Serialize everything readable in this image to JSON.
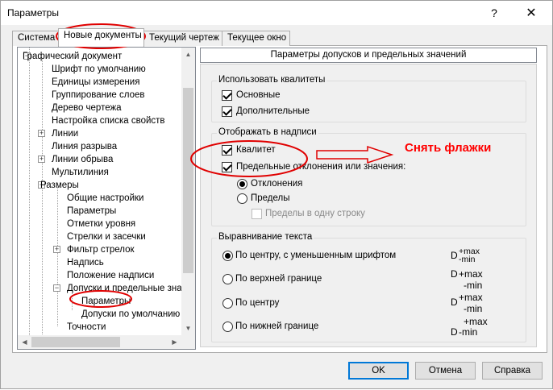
{
  "window": {
    "title": "Параметры",
    "help": "?",
    "close": "✕"
  },
  "tabs": [
    "Система",
    "Новые документы",
    "Текущий чертеж",
    "Текущее окно"
  ],
  "tree": [
    {
      "label": "Графический документ",
      "exp": "−"
    },
    {
      "label": "Шрифт по умолчанию"
    },
    {
      "label": "Единицы измерения"
    },
    {
      "label": "Группирование слоев"
    },
    {
      "label": "Дерево чертежа"
    },
    {
      "label": "Настройка списка свойств"
    },
    {
      "label": "Линии",
      "exp": "+"
    },
    {
      "label": "Линия разрыва"
    },
    {
      "label": "Линии обрыва",
      "exp": "+"
    },
    {
      "label": "Мультилиния"
    },
    {
      "label": "Размеры",
      "exp": "−"
    },
    {
      "label": "Общие настройки"
    },
    {
      "label": "Параметры"
    },
    {
      "label": "Отметки уровня"
    },
    {
      "label": "Стрелки и засечки"
    },
    {
      "label": "Фильтр стрелок",
      "exp": "+"
    },
    {
      "label": "Надпись"
    },
    {
      "label": "Положение надписи"
    },
    {
      "label": "Допуски и предельные знач",
      "exp": "−"
    },
    {
      "label": "Параметры"
    },
    {
      "label": "Допуски по умолчанию"
    },
    {
      "label": "Точности"
    }
  ],
  "panel": {
    "header": "Параметры допусков и предельных значений",
    "grp1": {
      "title": "Использовать квалитеты",
      "basic": "Основные",
      "extra": "Дополнительные"
    },
    "grp2": {
      "title": "Отображать в надписи",
      "qualitet": "Квалитет",
      "limits": "Предельные отклонения или значения:",
      "deviations": "Отклонения",
      "limits_values": "Пределы",
      "one_line": "Пределы в одну строку"
    },
    "grp3": {
      "title": "Выравнивание текста",
      "center_small": "По центру, с уменьшенным шрифтом",
      "top": "По верхней границе",
      "center": "По центру",
      "bottom": "По нижней границе",
      "d": "D",
      "max": "+max",
      "min": "-min"
    }
  },
  "buttons": {
    "ok": "OK",
    "cancel": "Отмена",
    "help": "Справка"
  },
  "annotation": {
    "text": "Снять флажки",
    "color": "#ff0000"
  },
  "colors": {
    "focus_border": "#0078d7",
    "window_bg": "#f0f0f0"
  }
}
